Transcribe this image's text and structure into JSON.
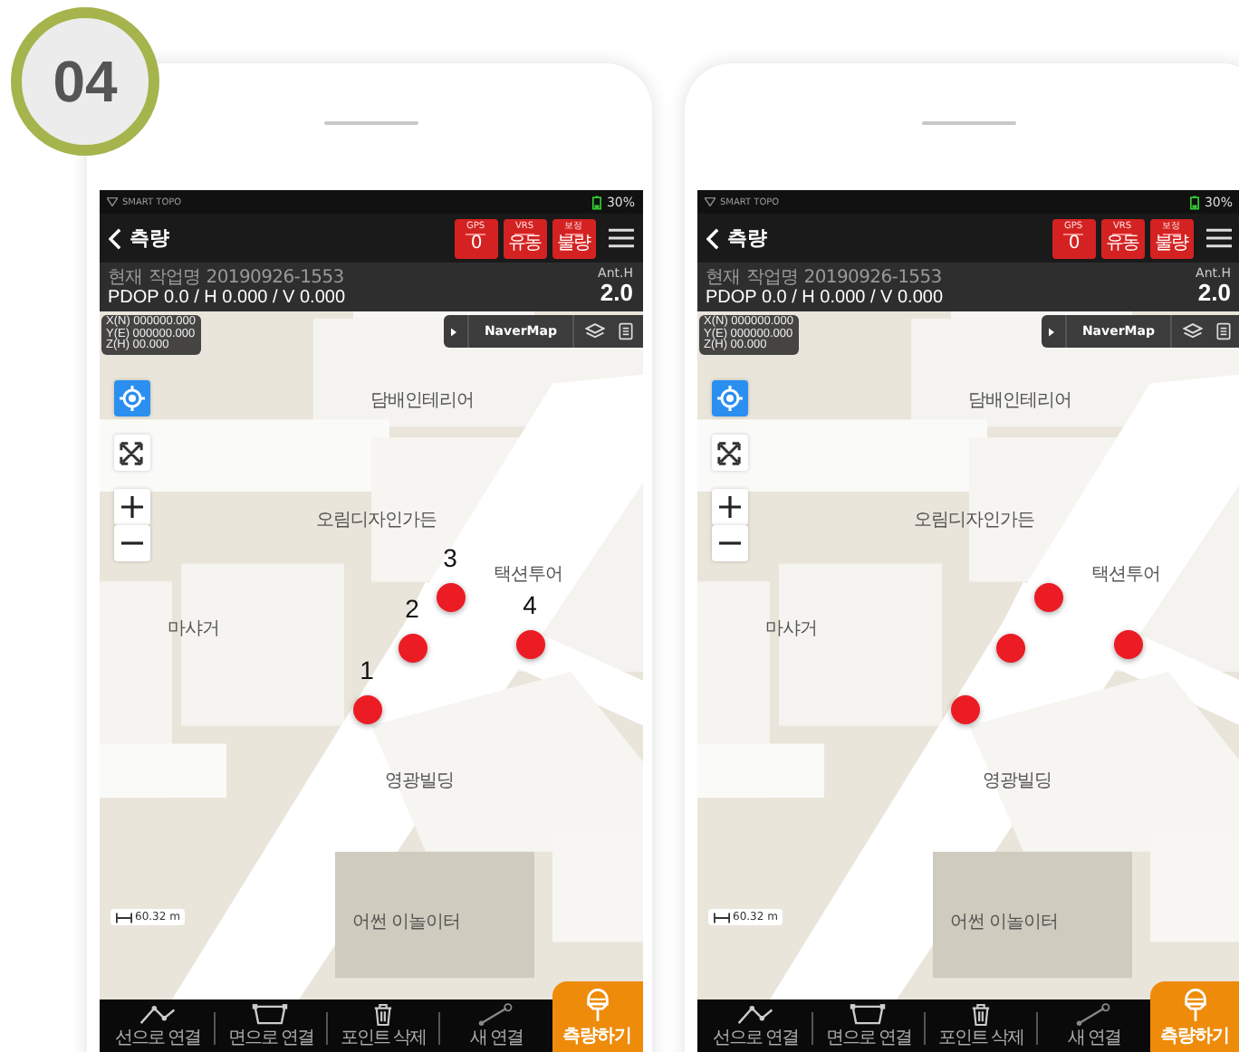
{
  "badge": "04",
  "screens": [
    {
      "status": {
        "app": "SMART TOPO",
        "battery": "30%"
      },
      "header": {
        "title": "측량",
        "indicators": [
          {
            "label": "GPS",
            "value": "0"
          },
          {
            "label": "VRS",
            "value": "유동"
          },
          {
            "label": "보정",
            "value": "불량"
          }
        ]
      },
      "info": {
        "job": "현재 작업명 20190926-1553",
        "dop": "PDOP 0.0 / H 0.000 / V 0.000",
        "ant_label": "Ant.H",
        "ant_value": "2.0"
      },
      "coords": [
        "X(N) 000000.000",
        "Y(E) 000000.000",
        "Z(H) 00.000"
      ],
      "map_source": "NaverMap",
      "map_labels": [
        "담배인테리어",
        "오림디자인가든",
        "택션투어",
        "마샤거",
        "영광빌딩",
        "어썬 이놀이터"
      ],
      "scale": "60.32 m",
      "markers": [
        {
          "kind": "numbered",
          "label": "1"
        },
        {
          "kind": "numbered",
          "label": "2"
        },
        {
          "kind": "numbered",
          "label": "3"
        },
        {
          "kind": "numbered",
          "label": "4"
        }
      ],
      "toolbar": [
        "선으로 연결",
        "면으로 연결",
        "포인트 삭제",
        "새 연결"
      ],
      "survey_button": "측량하기"
    },
    {
      "status": {
        "app": "SMART TOPO",
        "battery": "30%"
      },
      "header": {
        "title": "측량",
        "indicators": [
          {
            "label": "GPS",
            "value": "0"
          },
          {
            "label": "VRS",
            "value": "유동"
          },
          {
            "label": "보정",
            "value": "불량"
          }
        ]
      },
      "info": {
        "job": "현재 작업명 20190926-1553",
        "dop": "PDOP 0.0 / H 0.000 / V 0.000",
        "ant_label": "Ant.H",
        "ant_value": "2.0"
      },
      "coords": [
        "X(N) 000000.000",
        "Y(E) 000000.000",
        "Z(H) 00.000"
      ],
      "map_source": "NaverMap",
      "map_labels": [
        "담배인테리어",
        "오림디자인가든",
        "택션투어",
        "마샤거",
        "영광빌딩",
        "어썬 이놀이터"
      ],
      "scale": "60.32 m",
      "markers": [
        {
          "kind": "plain"
        },
        {
          "kind": "plain"
        },
        {
          "kind": "plain"
        },
        {
          "kind": "plain"
        }
      ],
      "toolbar": [
        "선으로 연결",
        "면으로 연결",
        "포인트 삭제",
        "새 연결"
      ],
      "survey_button": "측량하기"
    }
  ]
}
